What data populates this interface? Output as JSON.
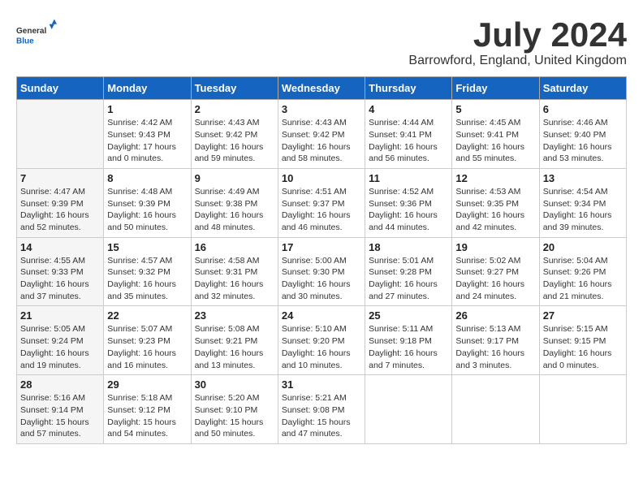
{
  "logo": {
    "text_general": "General",
    "text_blue": "Blue"
  },
  "title": "July 2024",
  "location": "Barrowford, England, United Kingdom",
  "days_of_week": [
    "Sunday",
    "Monday",
    "Tuesday",
    "Wednesday",
    "Thursday",
    "Friday",
    "Saturday"
  ],
  "weeks": [
    [
      {
        "day": "",
        "info": ""
      },
      {
        "day": "1",
        "info": "Sunrise: 4:42 AM\nSunset: 9:43 PM\nDaylight: 17 hours\nand 0 minutes."
      },
      {
        "day": "2",
        "info": "Sunrise: 4:43 AM\nSunset: 9:42 PM\nDaylight: 16 hours\nand 59 minutes."
      },
      {
        "day": "3",
        "info": "Sunrise: 4:43 AM\nSunset: 9:42 PM\nDaylight: 16 hours\nand 58 minutes."
      },
      {
        "day": "4",
        "info": "Sunrise: 4:44 AM\nSunset: 9:41 PM\nDaylight: 16 hours\nand 56 minutes."
      },
      {
        "day": "5",
        "info": "Sunrise: 4:45 AM\nSunset: 9:41 PM\nDaylight: 16 hours\nand 55 minutes."
      },
      {
        "day": "6",
        "info": "Sunrise: 4:46 AM\nSunset: 9:40 PM\nDaylight: 16 hours\nand 53 minutes."
      }
    ],
    [
      {
        "day": "7",
        "info": "Sunrise: 4:47 AM\nSunset: 9:39 PM\nDaylight: 16 hours\nand 52 minutes."
      },
      {
        "day": "8",
        "info": "Sunrise: 4:48 AM\nSunset: 9:39 PM\nDaylight: 16 hours\nand 50 minutes."
      },
      {
        "day": "9",
        "info": "Sunrise: 4:49 AM\nSunset: 9:38 PM\nDaylight: 16 hours\nand 48 minutes."
      },
      {
        "day": "10",
        "info": "Sunrise: 4:51 AM\nSunset: 9:37 PM\nDaylight: 16 hours\nand 46 minutes."
      },
      {
        "day": "11",
        "info": "Sunrise: 4:52 AM\nSunset: 9:36 PM\nDaylight: 16 hours\nand 44 minutes."
      },
      {
        "day": "12",
        "info": "Sunrise: 4:53 AM\nSunset: 9:35 PM\nDaylight: 16 hours\nand 42 minutes."
      },
      {
        "day": "13",
        "info": "Sunrise: 4:54 AM\nSunset: 9:34 PM\nDaylight: 16 hours\nand 39 minutes."
      }
    ],
    [
      {
        "day": "14",
        "info": "Sunrise: 4:55 AM\nSunset: 9:33 PM\nDaylight: 16 hours\nand 37 minutes."
      },
      {
        "day": "15",
        "info": "Sunrise: 4:57 AM\nSunset: 9:32 PM\nDaylight: 16 hours\nand 35 minutes."
      },
      {
        "day": "16",
        "info": "Sunrise: 4:58 AM\nSunset: 9:31 PM\nDaylight: 16 hours\nand 32 minutes."
      },
      {
        "day": "17",
        "info": "Sunrise: 5:00 AM\nSunset: 9:30 PM\nDaylight: 16 hours\nand 30 minutes."
      },
      {
        "day": "18",
        "info": "Sunrise: 5:01 AM\nSunset: 9:28 PM\nDaylight: 16 hours\nand 27 minutes."
      },
      {
        "day": "19",
        "info": "Sunrise: 5:02 AM\nSunset: 9:27 PM\nDaylight: 16 hours\nand 24 minutes."
      },
      {
        "day": "20",
        "info": "Sunrise: 5:04 AM\nSunset: 9:26 PM\nDaylight: 16 hours\nand 21 minutes."
      }
    ],
    [
      {
        "day": "21",
        "info": "Sunrise: 5:05 AM\nSunset: 9:24 PM\nDaylight: 16 hours\nand 19 minutes."
      },
      {
        "day": "22",
        "info": "Sunrise: 5:07 AM\nSunset: 9:23 PM\nDaylight: 16 hours\nand 16 minutes."
      },
      {
        "day": "23",
        "info": "Sunrise: 5:08 AM\nSunset: 9:21 PM\nDaylight: 16 hours\nand 13 minutes."
      },
      {
        "day": "24",
        "info": "Sunrise: 5:10 AM\nSunset: 9:20 PM\nDaylight: 16 hours\nand 10 minutes."
      },
      {
        "day": "25",
        "info": "Sunrise: 5:11 AM\nSunset: 9:18 PM\nDaylight: 16 hours\nand 7 minutes."
      },
      {
        "day": "26",
        "info": "Sunrise: 5:13 AM\nSunset: 9:17 PM\nDaylight: 16 hours\nand 3 minutes."
      },
      {
        "day": "27",
        "info": "Sunrise: 5:15 AM\nSunset: 9:15 PM\nDaylight: 16 hours\nand 0 minutes."
      }
    ],
    [
      {
        "day": "28",
        "info": "Sunrise: 5:16 AM\nSunset: 9:14 PM\nDaylight: 15 hours\nand 57 minutes."
      },
      {
        "day": "29",
        "info": "Sunrise: 5:18 AM\nSunset: 9:12 PM\nDaylight: 15 hours\nand 54 minutes."
      },
      {
        "day": "30",
        "info": "Sunrise: 5:20 AM\nSunset: 9:10 PM\nDaylight: 15 hours\nand 50 minutes."
      },
      {
        "day": "31",
        "info": "Sunrise: 5:21 AM\nSunset: 9:08 PM\nDaylight: 15 hours\nand 47 minutes."
      },
      {
        "day": "",
        "info": ""
      },
      {
        "day": "",
        "info": ""
      },
      {
        "day": "",
        "info": ""
      }
    ]
  ]
}
